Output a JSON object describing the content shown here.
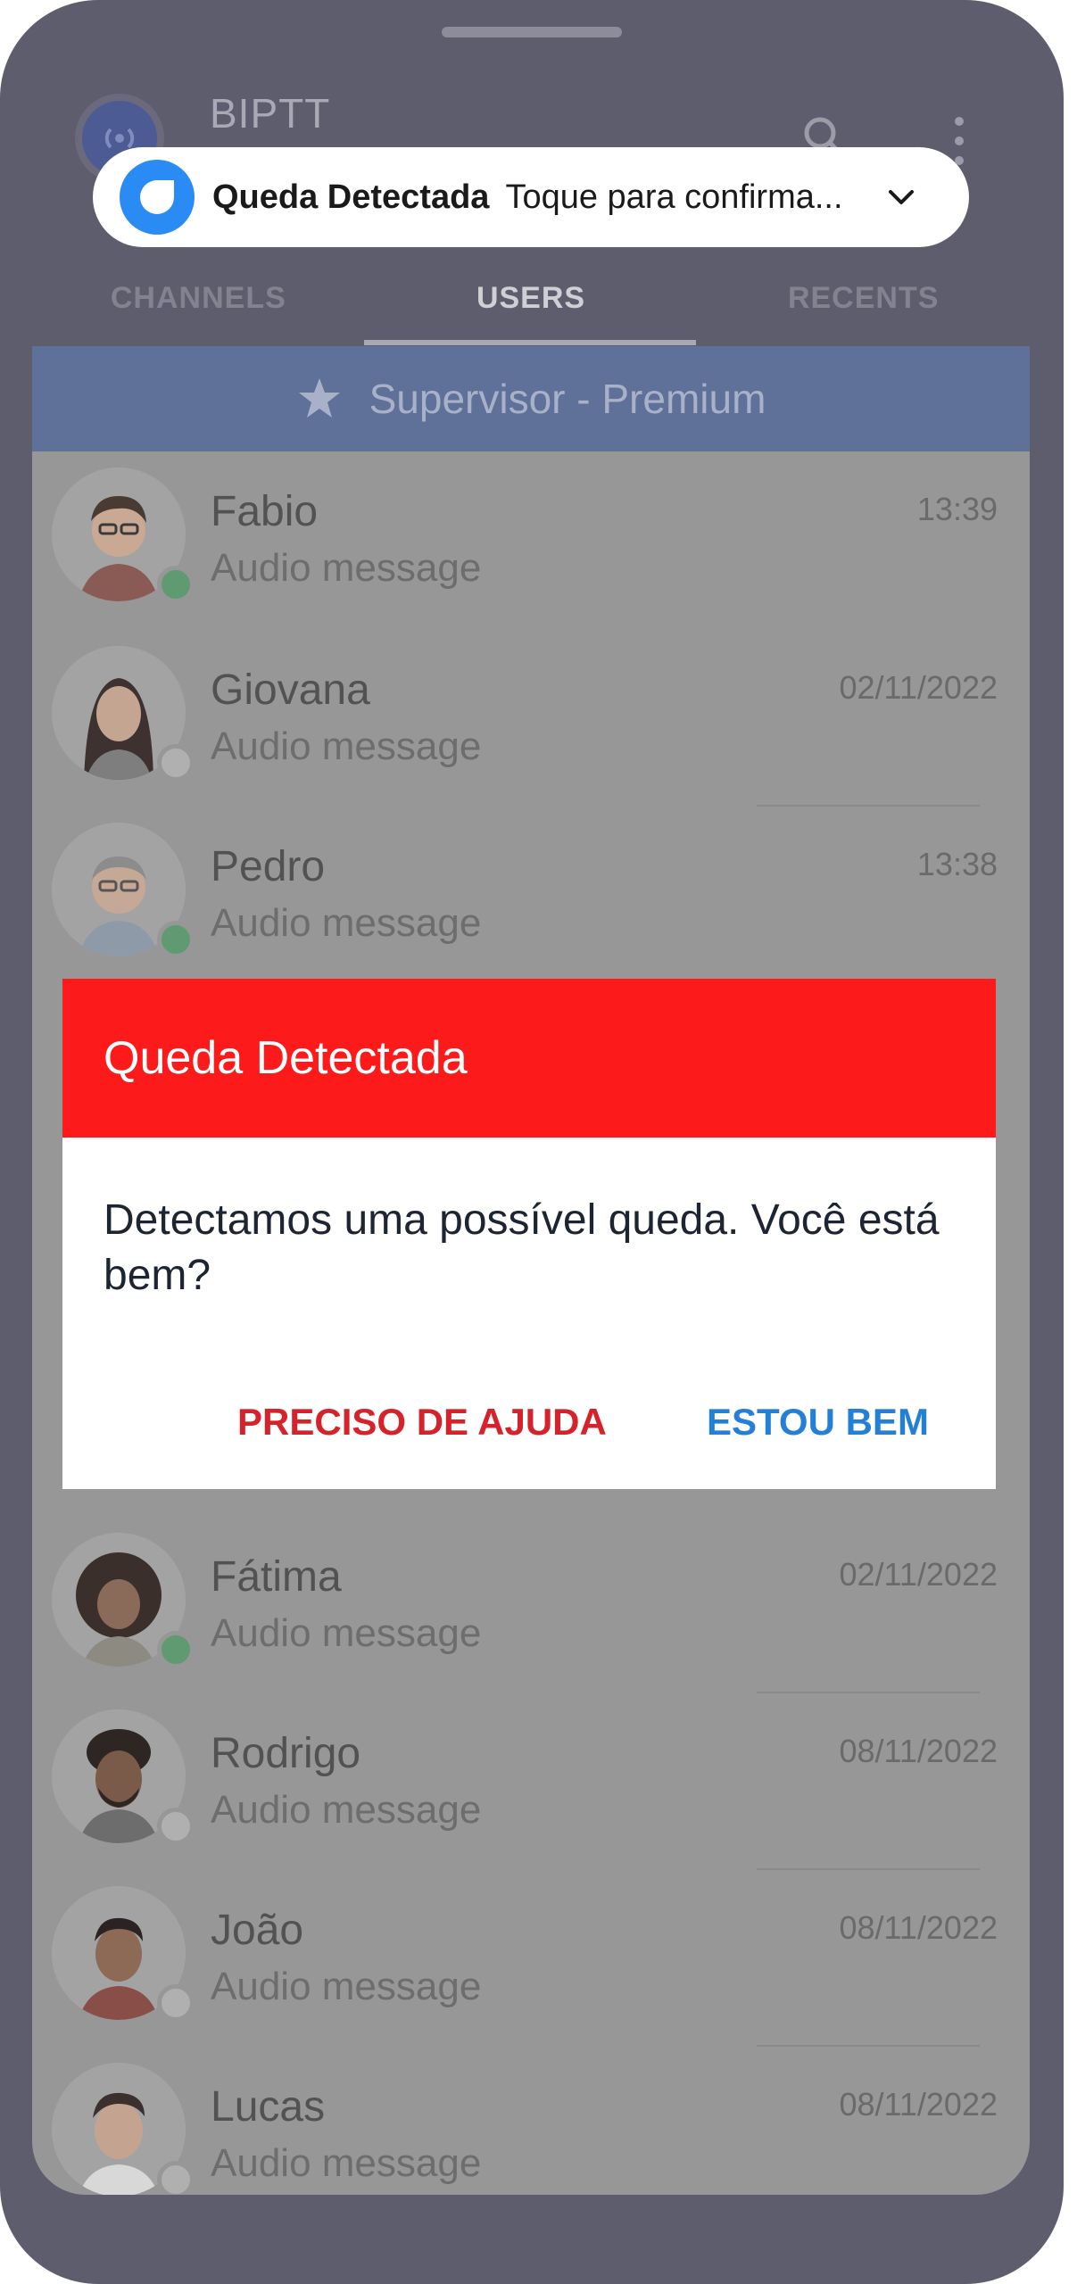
{
  "app": {
    "title": "BIPTT"
  },
  "notification": {
    "title": "Queda Detectada",
    "body": "Toque para confirma..."
  },
  "tabs": [
    {
      "label": "CHANNELS",
      "active": false
    },
    {
      "label": "USERS",
      "active": true
    },
    {
      "label": "RECENTS",
      "active": false
    }
  ],
  "supervisor": {
    "label": "Supervisor  -  Premium"
  },
  "contacts": [
    {
      "name": "Fabio",
      "message": "Audio message",
      "time": "13:39",
      "status": "online"
    },
    {
      "name": "Giovana",
      "message": "Audio message",
      "time": "02/11/2022",
      "status": "offline"
    },
    {
      "name": "Pedro",
      "message": "Audio message",
      "time": "13:38",
      "status": "online"
    },
    {
      "name": "Fátima",
      "message": "Audio message",
      "time": "02/11/2022",
      "status": "online"
    },
    {
      "name": "Rodrigo",
      "message": "Audio message",
      "time": "08/11/2022",
      "status": "offline"
    },
    {
      "name": "João",
      "message": "Audio message",
      "time": "08/11/2022",
      "status": "offline"
    },
    {
      "name": "Lucas",
      "message": "Audio message",
      "time": "08/11/2022",
      "status": "offline"
    }
  ],
  "dialog": {
    "title": "Queda Detectada",
    "message": "Detectamos uma possível queda. Você está bem?",
    "help_label": "PRECISO DE AJUDA",
    "ok_label": "ESTOU BEM"
  },
  "colors": {
    "dialog_header": "#fd1a1a",
    "help_button": "#d6232b",
    "ok_button": "#2480d6",
    "notification_icon": "#2b8bf5",
    "status_online": "#5f9a70",
    "status_offline": "#b0b0b0"
  },
  "icons": {
    "app_logo": "radio-signal-icon",
    "search": "search-icon",
    "menu": "more-vertical-icon",
    "notification": "app-notification-icon",
    "chevron": "chevron-down-icon",
    "supervisor": "star-icon"
  }
}
